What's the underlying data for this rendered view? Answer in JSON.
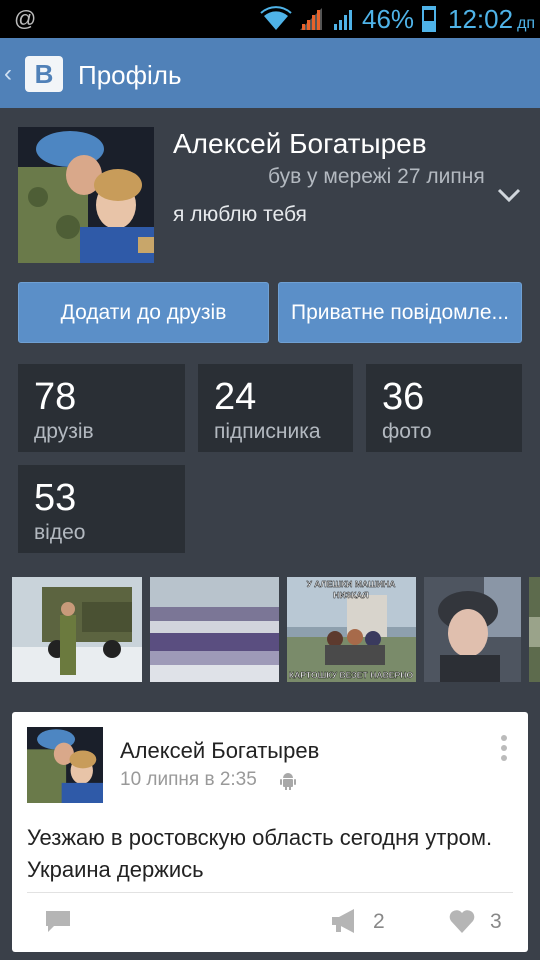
{
  "status_bar": {
    "notification_icon": "@",
    "battery_percent": "46%",
    "battery_level": 0.46,
    "time": "12:02",
    "time_suffix": "дп"
  },
  "header": {
    "logo_text": "B",
    "title": "Профіль"
  },
  "profile": {
    "name": "Алексей Богатырев",
    "last_seen": "був у мережі 27 липня",
    "status": "я люблю тебя",
    "add_friend_label": "Додати до друзів",
    "message_label": "Приватне повідомле..."
  },
  "stats": [
    {
      "value": "78",
      "label": "друзів"
    },
    {
      "value": "24",
      "label": "підписника"
    },
    {
      "value": "36",
      "label": "фото"
    },
    {
      "value": "53",
      "label": "відео"
    }
  ],
  "photos": {
    "meme_top": "У АЛЕШКИ МАШИНА",
    "meme_top2": "НИЗКАЯ",
    "meme_bottom": "КАРТОШКУ ВЕЗЕТ НАВЕРНО"
  },
  "post": {
    "author": "Алексей Богатырев",
    "date": "10 липня в 2:35",
    "text": "Уезжаю в ростовскую область сегодня утром. Украина держись",
    "shares": "2",
    "likes": "3"
  },
  "colors": {
    "header": "#5081b8",
    "background": "#3a4049",
    "stat_tile": "#2a2f35",
    "button": "#5b8fc8",
    "status_accent": "#4fb3e8"
  }
}
